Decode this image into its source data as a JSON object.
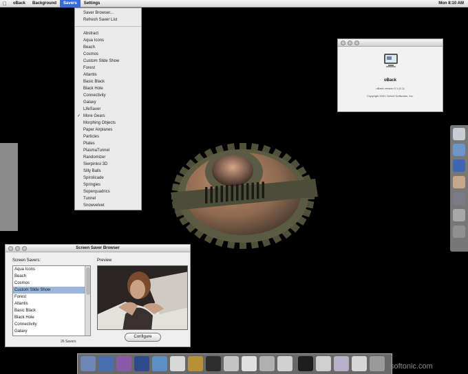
{
  "menubar": {
    "app": "oBack",
    "items": [
      "Background",
      "Savers",
      "Settings"
    ],
    "active_index": 1,
    "clock": "Mon 8:10 AM"
  },
  "savers_menu": {
    "actions": [
      "Saver Browser...",
      "Refresh Saver List"
    ],
    "items": [
      "Abstract",
      "Aqua Icons",
      "Beach",
      "Cosmos",
      "Custom Slide Show",
      "Forest",
      "Atlantis",
      "Basic Black",
      "Black Hole",
      "Connectivity",
      "Galaxy",
      "LifeSaver",
      "More Gears",
      "Morphing Objects",
      "Paper Airplanes",
      "Particles",
      "Plates",
      "PlasmaTunnel",
      "Randomizer",
      "Sierpinksi 3D",
      "Silly Balls",
      "Spirolicade",
      "Springies",
      "Superquadrics",
      "Tunnel",
      "Snowvelvet"
    ],
    "checked": "More Gears"
  },
  "about_window": {
    "name": "oBack",
    "version": "oBack version 0.1 (0.1)",
    "copyright": "Copyright 2001 Oxford Softworks, Inc."
  },
  "browser_window": {
    "title": "Screen Saver Browser",
    "list_label": "Screen Savers:",
    "items": [
      "Aqua Icons",
      "Beach",
      "Cosmos",
      "Custom Slide Show",
      "Forest",
      "Atlantis",
      "Basic Black",
      "Black Hole",
      "Connectivity",
      "Galaxy"
    ],
    "selected": "Custom Slide Show",
    "count": "26 Savers",
    "preview_label": "Preview",
    "configure_label": "Configure"
  },
  "watermark": "softonic.com",
  "colors": {
    "menu_highlight": "#3a6bd4",
    "list_selection": "#9cb7db",
    "desktop": "#000000",
    "gear": "#56573f",
    "gear_center": "#9b6e52"
  }
}
